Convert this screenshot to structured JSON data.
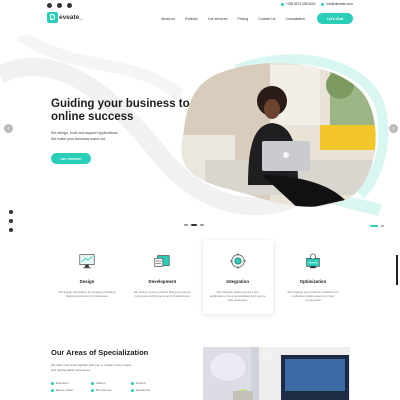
{
  "topbar": {
    "social": [
      "facebook-icon",
      "instagram-icon",
      "pinterest-icon"
    ],
    "phone": "+336 8974 095 0630",
    "email": "info@deveate.com"
  },
  "header": {
    "logo_letter": "D",
    "logo_text": "eveate_",
    "nav": [
      "About us",
      "Portfolio",
      "Our services",
      "Pricing",
      "Contact Us",
      "Consultation"
    ],
    "cta": "Let's Chat"
  },
  "hero": {
    "title": "Guiding your business to online success",
    "sub_line1": "We design, build and support applications.",
    "sub_line2": "We make your business stand out",
    "button": "GET STARTED"
  },
  "services": [
    {
      "title": "Design",
      "desc": "We design and deliver by creating a befitting digital experience for businesses",
      "icon": "design-icon"
    },
    {
      "title": "Development",
      "desc": "We deliver custom product fitting and secure corporate environments and infrastructures",
      "icon": "development-icon"
    },
    {
      "title": "Integration",
      "desc": "We integrate tested services and applications into a consolidated and secure web ecosystem",
      "icon": "integration-icon"
    },
    {
      "title": "Optimization",
      "desc": "We upgrade and enhance outdated and ineffective digital systems or their components",
      "icon": "optimization-icon"
    }
  ],
  "specialization": {
    "title": "Our Areas of Specialization",
    "desc": "We listen and work together with you to create a truly unique and unforgettable experience.",
    "items": [
      "Education",
      "Startup",
      "Fintech",
      "Beauty Salon",
      "Bus Service",
      "Restaurant"
    ]
  },
  "colors": {
    "accent": "#2bcfb9",
    "dark": "#1d1d1d"
  }
}
